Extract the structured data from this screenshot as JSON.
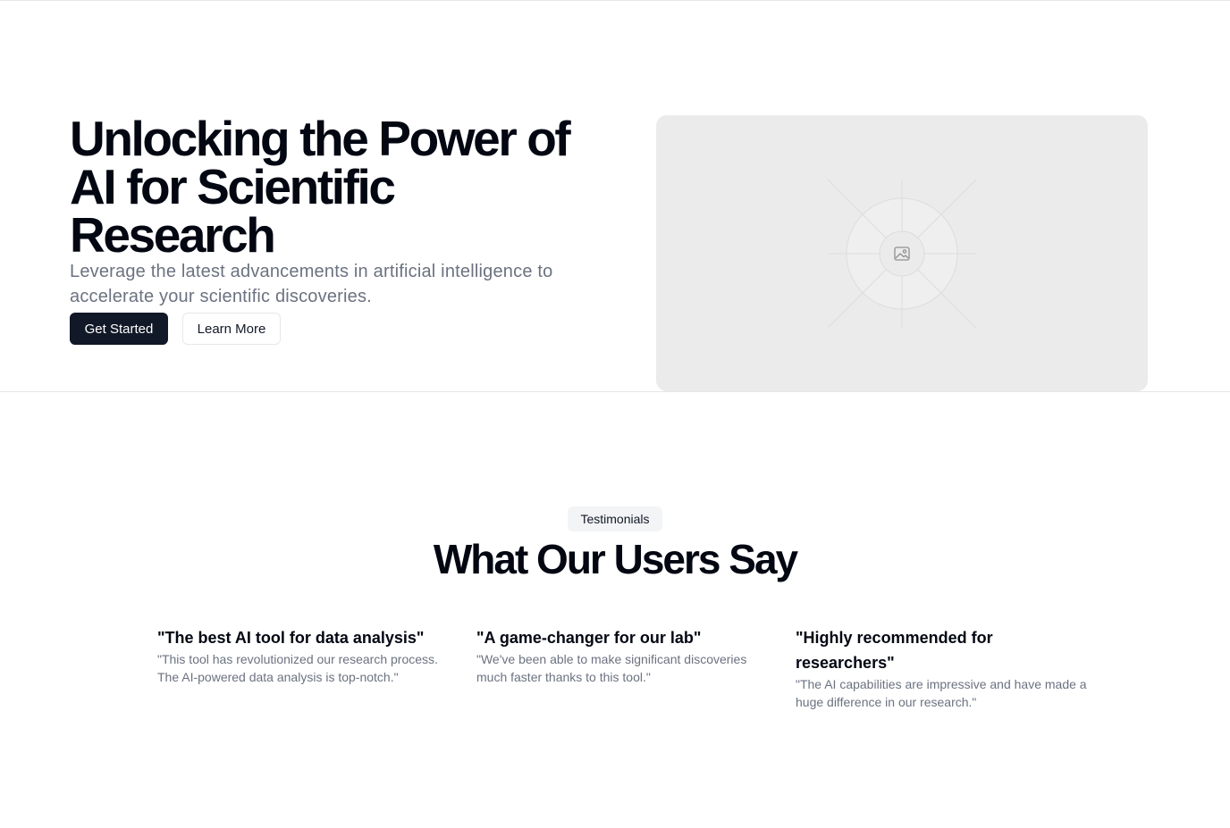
{
  "hero": {
    "title": "Unlocking the Power of AI for Scientific Research",
    "subtitle": "Leverage the latest advancements in artificial intelligence to accelerate your scientific discoveries.",
    "primary_button": "Get Started",
    "secondary_button": "Learn More",
    "image_icon": "image-placeholder-icon"
  },
  "testimonials": {
    "badge": "Testimonials",
    "title": "What Our Users Say",
    "items": [
      {
        "quote": "\"The best AI tool for data analysis\"",
        "body": "\"This tool has revolutionized our research process. The AI-powered data analysis is top-notch.\""
      },
      {
        "quote": "\"A game-changer for our lab\"",
        "body": "\"We've been able to make significant discoveries much faster thanks to this tool.\""
      },
      {
        "quote": "\"Highly recommended for researchers\"",
        "body": "\"The AI capabilities are impressive and have made a huge difference in our research.\""
      }
    ]
  },
  "colors": {
    "primary_button_bg": "#111827",
    "muted_text": "#6b7280",
    "placeholder_bg": "#ebebeb"
  }
}
